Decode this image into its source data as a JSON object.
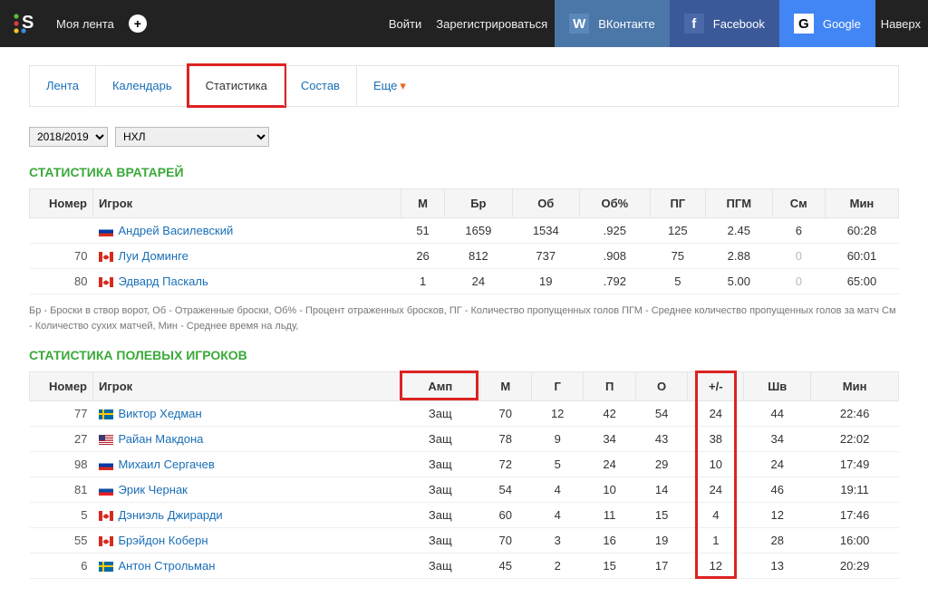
{
  "topbar": {
    "feed": "Моя лента",
    "login": "Войти",
    "register": "Зарегистрироваться",
    "vk": "ВКонтакте",
    "vk_icon": "W",
    "fb": "Facebook",
    "fb_icon": "f",
    "gg": "Google",
    "gg_icon": "G",
    "up": "Наверх"
  },
  "tabs": {
    "t0": "Лента",
    "t1": "Календарь",
    "t2": "Статистика",
    "t3": "Состав",
    "t4": "Еще"
  },
  "filters": {
    "season": "2018/2019",
    "league": "НХЛ"
  },
  "goalies": {
    "title": "СТАТИСТИКА ВРАТАРЕЙ",
    "headers": [
      "Номер",
      "Игрок",
      "М",
      "Бр",
      "Об",
      "Об%",
      "ПГ",
      "ПГМ",
      "См",
      "Мин"
    ],
    "rows": [
      {
        "num": "",
        "flag": "ru",
        "name": "Андрей Василевский",
        "m": "51",
        "br": "1659",
        "ob": "1534",
        "obp": ".925",
        "pg": "125",
        "pgm": "2.45",
        "sm": "6",
        "min": "60:28"
      },
      {
        "num": "70",
        "flag": "ca",
        "name": "Луи Доминге",
        "m": "26",
        "br": "812",
        "ob": "737",
        "obp": ".908",
        "pg": "75",
        "pgm": "2.88",
        "sm": "0",
        "sm_dim": true,
        "min": "60:01"
      },
      {
        "num": "80",
        "flag": "ca",
        "name": "Эдвард Паскаль",
        "m": "1",
        "br": "24",
        "ob": "19",
        "obp": ".792",
        "pg": "5",
        "pgm": "5.00",
        "sm": "0",
        "sm_dim": true,
        "min": "65:00"
      }
    ],
    "legend": "Бр - Броски в створ ворот, Об - Отраженные броски, Об% - Процент отраженных бросков, ПГ - Количество пропущенных голов ПГМ - Среднее количество пропущенных голов за матч См - Количество сухих матчей, Мин - Среднее время на льду,"
  },
  "skaters": {
    "title": "СТАТИСТИКА ПОЛЕВЫХ ИГРОКОВ",
    "headers": [
      "Номер",
      "Игрок",
      "Амп",
      "М",
      "Г",
      "П",
      "О",
      "+/-",
      "Шв",
      "Мин"
    ],
    "rows": [
      {
        "num": "77",
        "flag": "se",
        "name": "Виктор Хедман",
        "amp": "Защ",
        "m": "70",
        "g": "12",
        "p": "42",
        "o": "54",
        "pm": "24",
        "sh": "44",
        "min": "22:46"
      },
      {
        "num": "27",
        "flag": "us",
        "name": "Райан Макдона",
        "amp": "Защ",
        "m": "78",
        "g": "9",
        "p": "34",
        "o": "43",
        "pm": "38",
        "sh": "34",
        "min": "22:02"
      },
      {
        "num": "98",
        "flag": "ru",
        "name": "Михаил Сергачев",
        "amp": "Защ",
        "m": "72",
        "g": "5",
        "p": "24",
        "o": "29",
        "pm": "10",
        "sh": "24",
        "min": "17:49"
      },
      {
        "num": "81",
        "flag": "sk",
        "name": "Эрик Чернак",
        "amp": "Защ",
        "m": "54",
        "g": "4",
        "p": "10",
        "o": "14",
        "pm": "24",
        "sh": "46",
        "min": "19:11"
      },
      {
        "num": "5",
        "flag": "ca",
        "name": "Дэниэль Джирарди",
        "amp": "Защ",
        "m": "60",
        "g": "4",
        "p": "11",
        "o": "15",
        "pm": "4",
        "sh": "12",
        "min": "17:46"
      },
      {
        "num": "55",
        "flag": "ca",
        "name": "Брэйдон Коберн",
        "amp": "Защ",
        "m": "70",
        "g": "3",
        "p": "16",
        "o": "19",
        "pm": "1",
        "sh": "28",
        "min": "16:00"
      },
      {
        "num": "6",
        "flag": "se",
        "name": "Антон Строльман",
        "amp": "Защ",
        "m": "45",
        "g": "2",
        "p": "15",
        "o": "17",
        "pm": "12",
        "sh": "13",
        "min": "20:29"
      }
    ]
  }
}
